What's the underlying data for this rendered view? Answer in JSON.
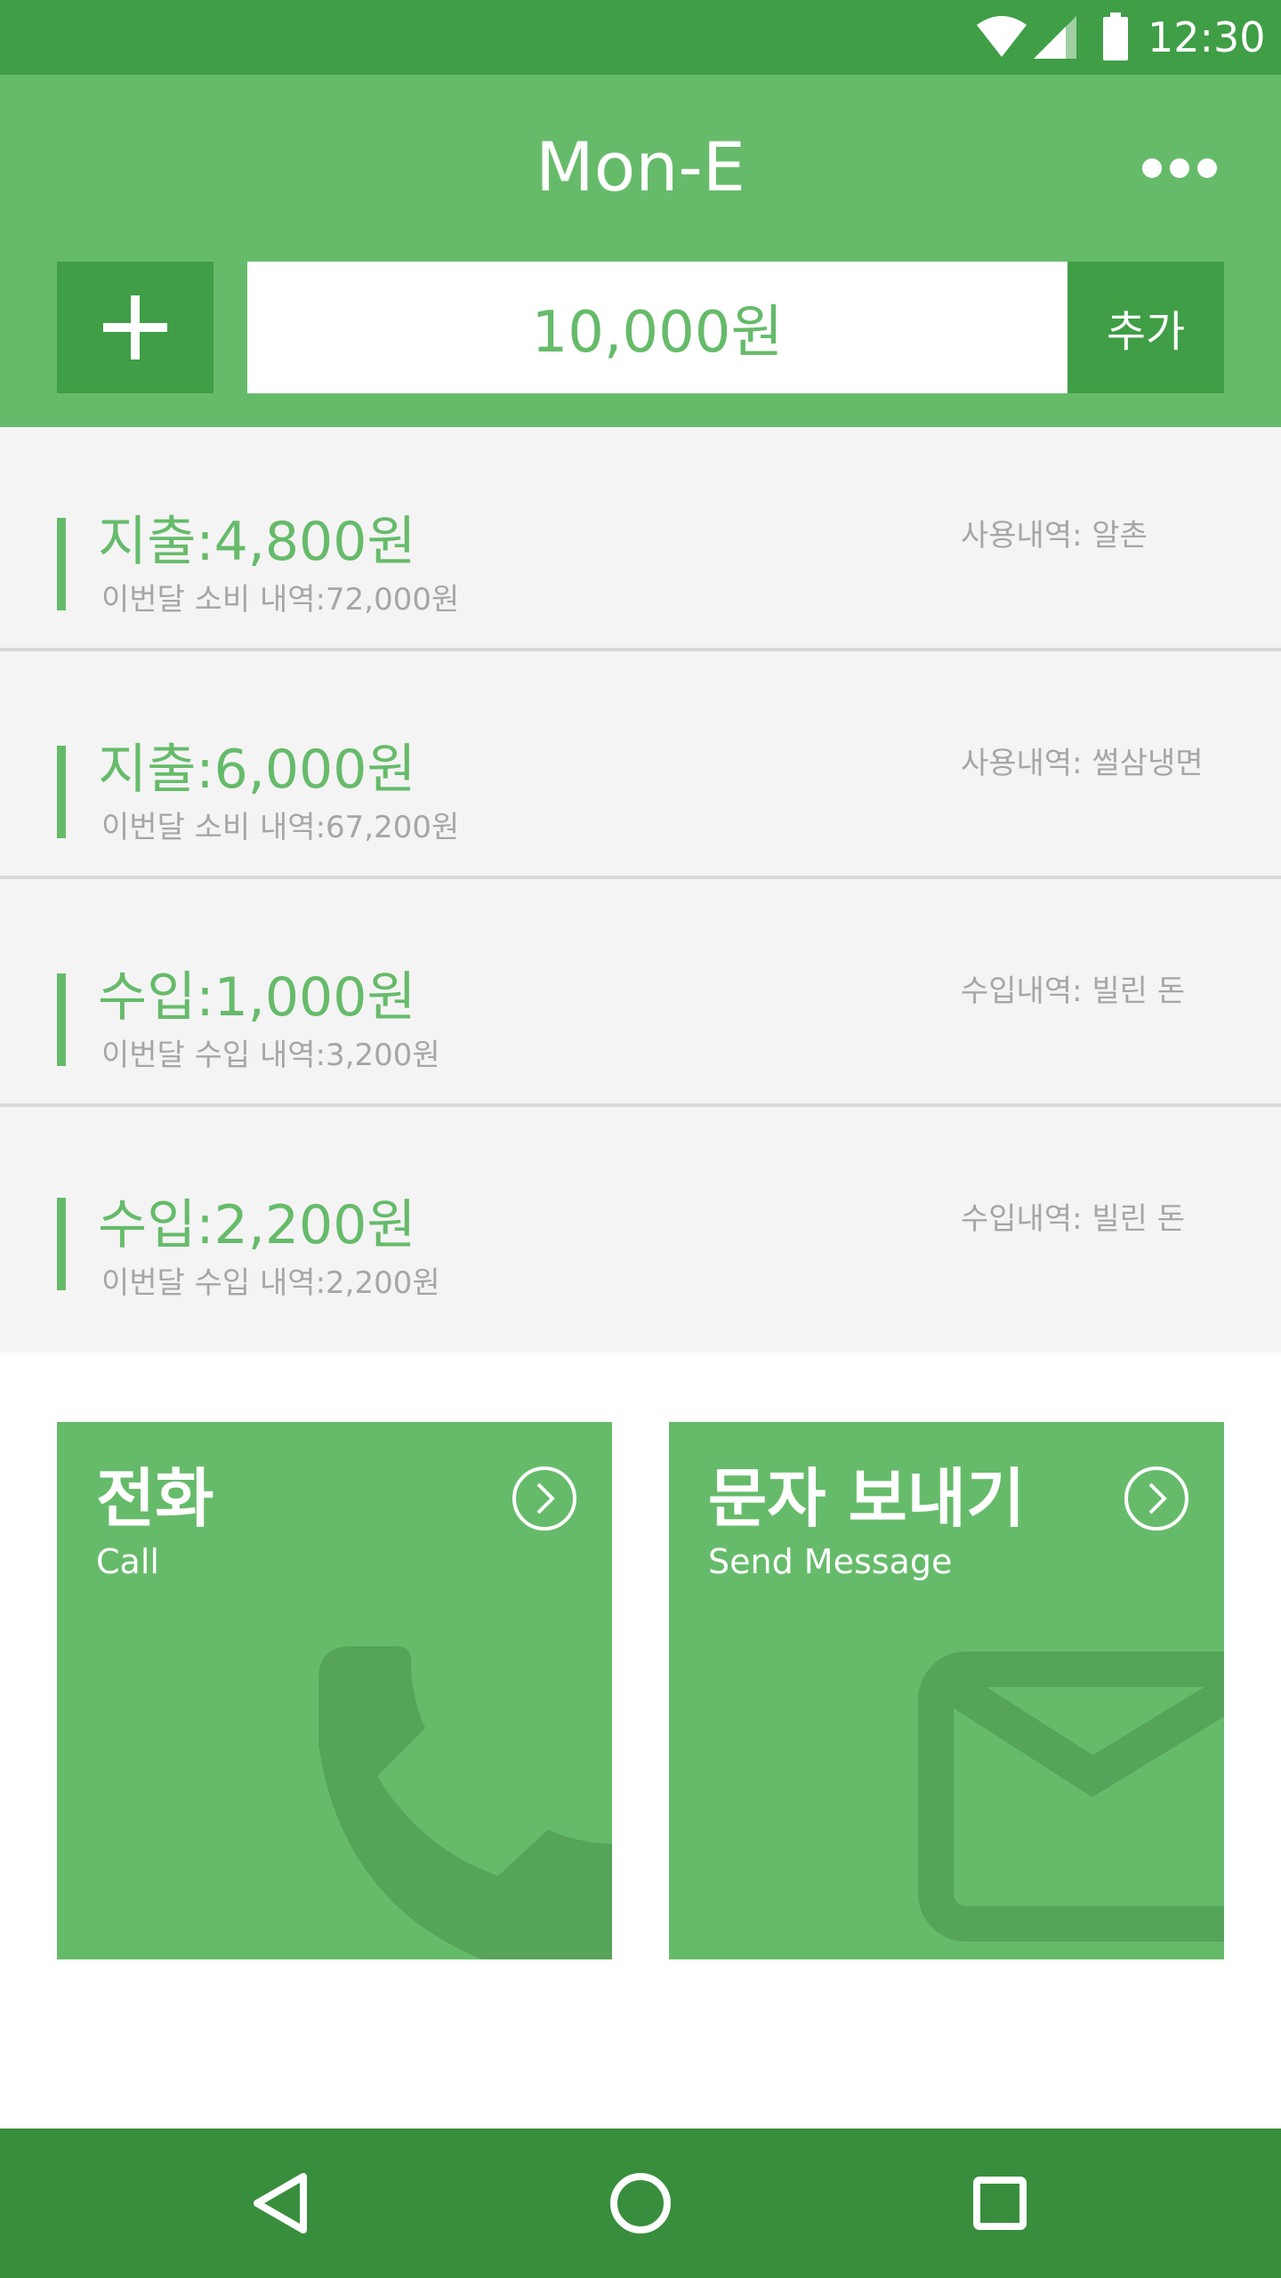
{
  "status_bar": {
    "time": "12:30",
    "icons": [
      "wifi-icon",
      "signal-icon",
      "battery-icon"
    ]
  },
  "app_bar": {
    "title": "Mon-E",
    "more_icon": "more-dots-icon"
  },
  "entry": {
    "plus_icon": "plus-icon",
    "amount_value": "10,000원",
    "add_label": "추가"
  },
  "transactions": [
    {
      "amount": "지출:4,800원",
      "monthly": "이번달 소비 내역:72,000원",
      "note": "사용내역: 알촌"
    },
    {
      "amount": "지출:6,000원",
      "monthly": "이번달 소비 내역:67,200원",
      "note": "사용내역: 썰삼냉면"
    },
    {
      "amount": "수입:1,000원",
      "monthly": "이번달 수입 내역:3,200원",
      "note": "수입내역: 빌린 돈"
    },
    {
      "amount": "수입:2,200원",
      "monthly": "이번달 수입 내역:2,200원",
      "note": "수입내역: 빌린 돈"
    }
  ],
  "cards": [
    {
      "title": "전화",
      "subtitle": "Call",
      "icon": "phone-icon"
    },
    {
      "title": "문자 보내기",
      "subtitle": "Send Message",
      "icon": "envelope-icon"
    }
  ],
  "nav_bar": {
    "icons": [
      "back-icon",
      "home-icon",
      "recents-icon"
    ]
  },
  "colors": {
    "primary": "#66bb6a",
    "primary_dark": "#3f9e46",
    "nav": "#388e3c",
    "list_bg": "#f4f4f4",
    "muted_text": "#a6a6a6"
  }
}
